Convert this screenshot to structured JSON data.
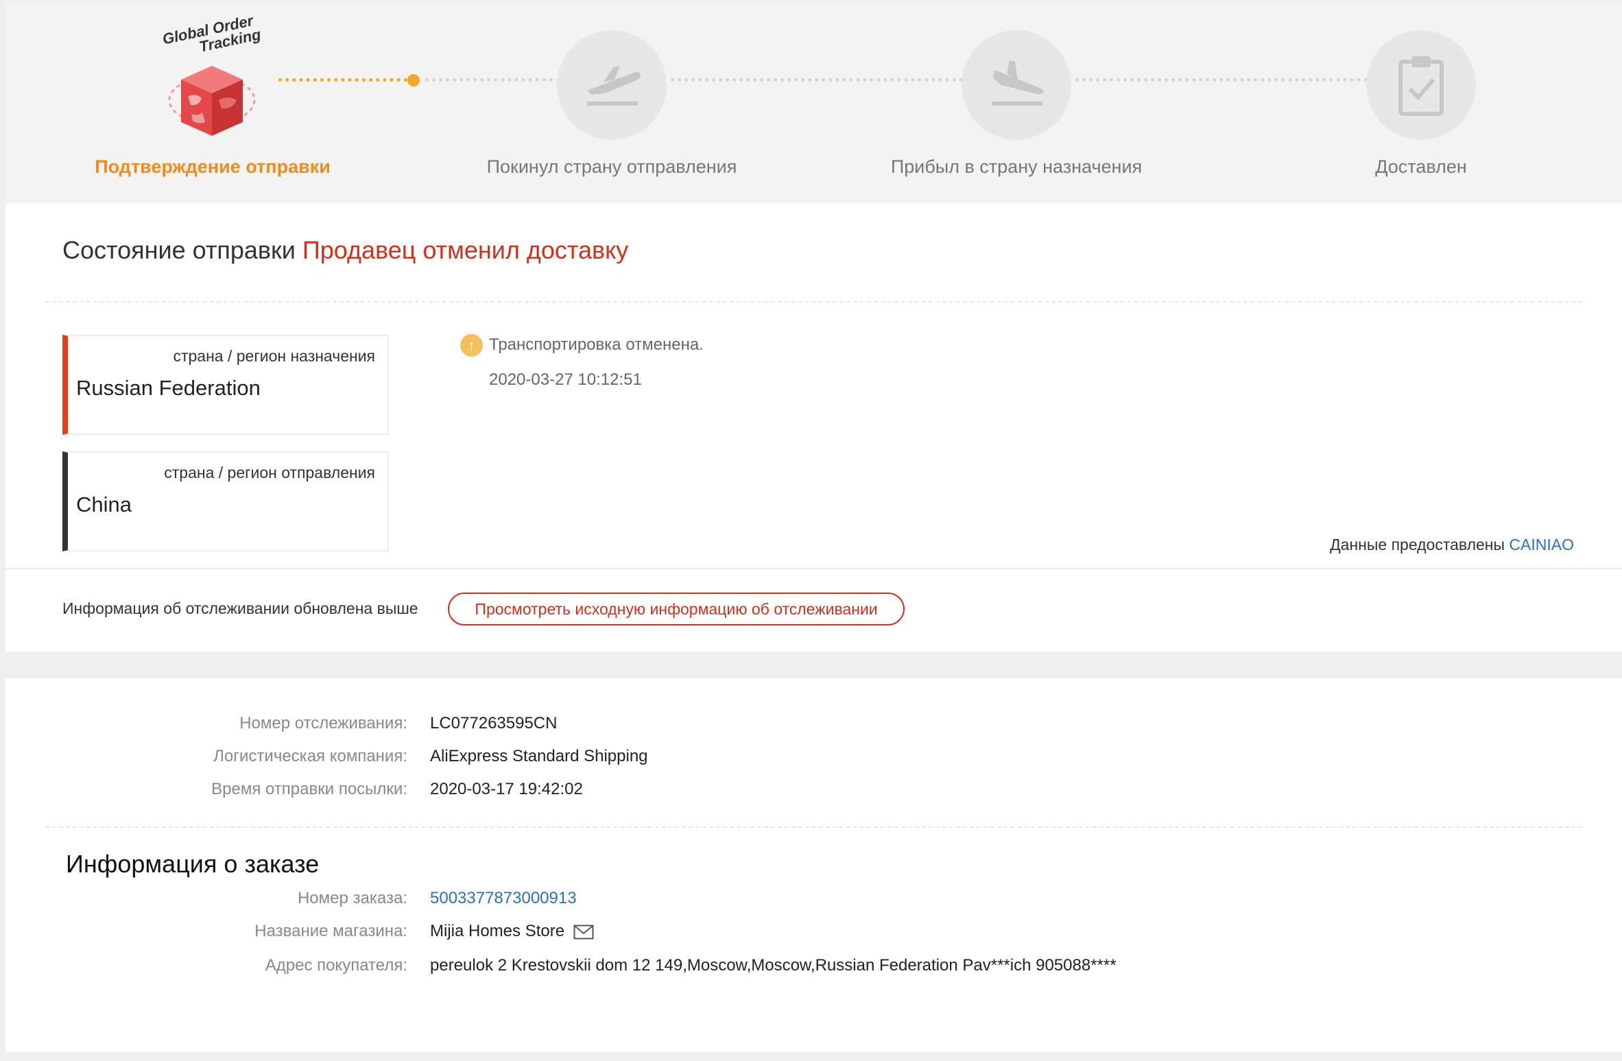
{
  "logo": {
    "line1": "Global Order",
    "line2": "Tracking"
  },
  "steps": [
    {
      "label": "Подтверждение отправки",
      "icon": "package-cube-icon"
    },
    {
      "label": "Покинул страну отправления",
      "icon": "plane-takeoff-icon"
    },
    {
      "label": "Прибыл в страну назначения",
      "icon": "plane-landing-icon"
    },
    {
      "label": "Доставлен",
      "icon": "clipboard-check-icon"
    }
  ],
  "status": {
    "label": "Состояние отправки",
    "value": "Продавец отменил доставку"
  },
  "destination": {
    "label": "страна / регион назначения",
    "value": "Russian Federation"
  },
  "origin": {
    "label": "страна / регион отправления",
    "value": "China"
  },
  "event": {
    "text": "Транспортировка отменена.",
    "time": "2020-03-27 10:12:51"
  },
  "provided": {
    "label": "Данные предоставлены",
    "source": "CAINIAO"
  },
  "update": {
    "text": "Информация об отслеживании обновлена выше",
    "button": "Просмотреть исходную информацию об отслеживании"
  },
  "shipping": {
    "tracking_label": "Номер отслеживания:",
    "tracking_value": "LC077263595CN",
    "company_label": "Логистическая компания:",
    "company_value": "AliExpress Standard Shipping",
    "time_label": "Время отправки посылки:",
    "time_value": "2020-03-17 19:42:02"
  },
  "order": {
    "title": "Информация о заказе",
    "number_label": "Номер заказа:",
    "number_value": "5003377873000913",
    "store_label": "Название магазина:",
    "store_value": "Mijia Homes Store",
    "address_label": "Адрес покупателя:",
    "address_value": "pereulok 2 Krestovskii dom 12 149,Moscow,Moscow,Russian Federation Pav***ich 905088****"
  },
  "colors": {
    "accent_orange": "#f08c1a",
    "status_red": "#d0311a",
    "link_blue": "#2a6fc4"
  }
}
